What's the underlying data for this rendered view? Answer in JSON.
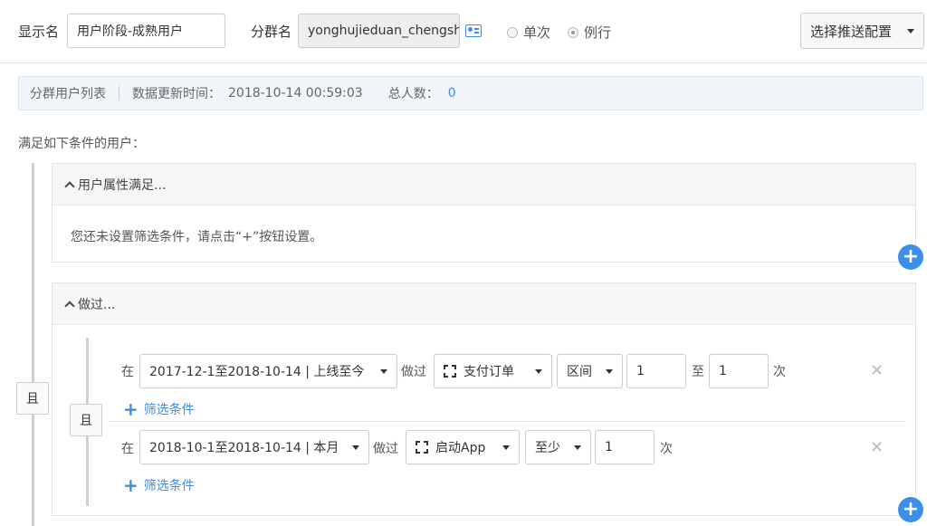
{
  "header": {
    "display_name_label": "显示名",
    "display_name_value": "用户阶段-成熟用户",
    "group_name_label": "分群名",
    "group_name_value": "yonghujieduan_chengshu",
    "radio_once": "单次",
    "radio_routine": "例行",
    "push_config_label": "选择推送配置"
  },
  "info": {
    "list_label": "分群用户列表",
    "update_label": "数据更新时间：",
    "update_time": "2018-10-14 00:59:03",
    "total_label": "总人数：",
    "total_count": "0"
  },
  "conditions_title": "满足如下条件的用户：",
  "outer_and": "且",
  "user_attr": {
    "title": "用户属性满足...",
    "empty_hint": "您还未设置筛选条件，请点击“+”按钮设置。"
  },
  "done": {
    "title": "做过...",
    "inner_and": "且",
    "rows": [
      {
        "in_label": "在",
        "date_range": "2017-12-1至2018-10-14 | 上线至今",
        "did_label": "做过",
        "event": "支付订单",
        "mode": "区间",
        "from": "1",
        "to_label": "至",
        "to": "1",
        "times_label": "次",
        "filter_label": "筛选条件"
      },
      {
        "in_label": "在",
        "date_range": "2018-10-1至2018-10-14 | 本月",
        "did_label": "做过",
        "event": "启动App",
        "mode": "至少",
        "from": "1",
        "times_label": "次",
        "filter_label": "筛选条件"
      }
    ]
  },
  "colors": {
    "accent": "#3b8fe8",
    "info_bg": "#f0f5fa"
  }
}
